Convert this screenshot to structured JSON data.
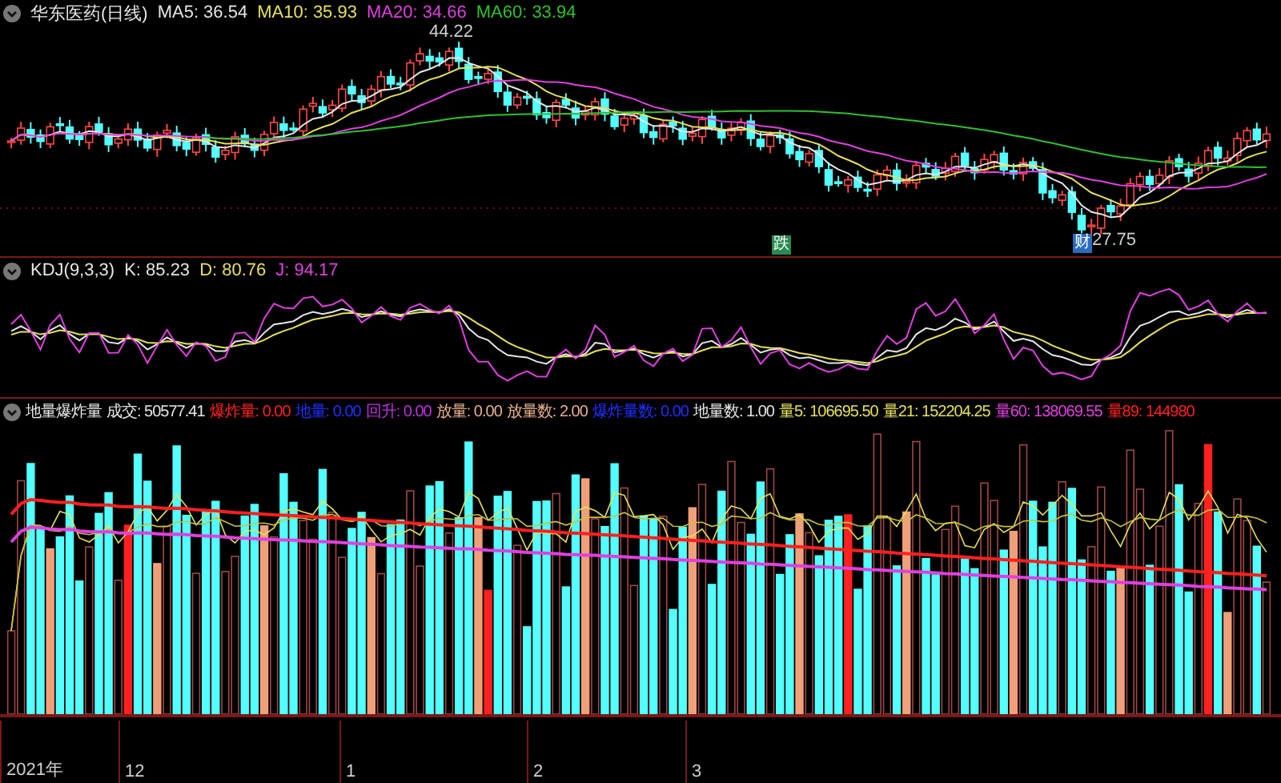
{
  "price_pane": {
    "title": "华东医药(日线)",
    "indicators": [
      {
        "label": "MA5: 36.54",
        "color": "#e6e6e6"
      },
      {
        "label": "MA10: 35.93",
        "color": "#e6e05a"
      },
      {
        "label": "MA20: 34.66",
        "color": "#e040e0"
      },
      {
        "label": "MA60: 33.94",
        "color": "#30c030"
      }
    ],
    "high_label": "44.22",
    "low_label": "27.75",
    "markers": [
      {
        "text": "跌",
        "color": "#2a8a50"
      },
      {
        "text": "财",
        "color": "#2a6cc0"
      }
    ]
  },
  "kdj_pane": {
    "title": "KDJ(9,3,3)",
    "indicators": [
      {
        "label": "K: 85.23",
        "color": "#e6e6e6"
      },
      {
        "label": "D: 80.76",
        "color": "#e6e05a"
      },
      {
        "label": "J: 94.17",
        "color": "#e040e0"
      }
    ]
  },
  "volume_pane": {
    "title": "地量爆炸量",
    "indicators": [
      {
        "label": "成交: 50577.41",
        "color": "#e6e6e6"
      },
      {
        "label": "爆炸量: 0.00",
        "color": "#ff2020"
      },
      {
        "label": "地量: 0.00",
        "color": "#2030ff"
      },
      {
        "label": "回升: 0.00",
        "color": "#c030e0"
      },
      {
        "label": "放量: 0.00",
        "color": "#e8b090"
      },
      {
        "label": "放量数: 2.00",
        "color": "#e8b090"
      },
      {
        "label": "爆炸量数: 0.00",
        "color": "#2030ff"
      },
      {
        "label": "地量数: 1.00",
        "color": "#e6e6e6"
      },
      {
        "label": "量5: 106695.50",
        "color": "#e6e05a"
      },
      {
        "label": "量21: 152204.25",
        "color": "#e6e05a"
      },
      {
        "label": "量60: 138069.55",
        "color": "#e040e0"
      },
      {
        "label": "量89: 144980",
        "color": "#ff2020"
      }
    ]
  },
  "time_axis": {
    "labels": [
      "2021年",
      "12",
      "1",
      "2",
      "3"
    ]
  }
}
